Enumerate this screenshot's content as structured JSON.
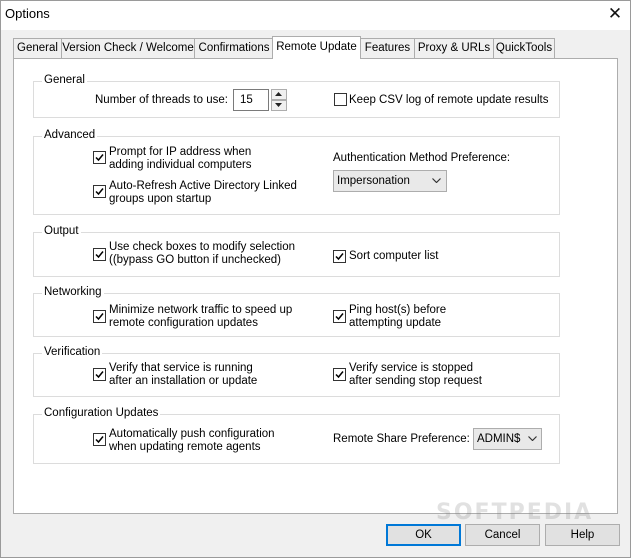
{
  "window": {
    "title": "Options",
    "close_glyph": "✕"
  },
  "tabs": [
    "General",
    "Version Check / Welcome",
    "Confirmations",
    "Remote Update",
    "Features",
    "Proxy & URLs",
    "QuickTools"
  ],
  "active_tab": "Remote Update",
  "general": {
    "label": "General",
    "threads_label": "Number of threads to use:",
    "threads_value": "15",
    "keep_csv": {
      "label": "Keep CSV log of remote update results",
      "checked": false
    }
  },
  "advanced": {
    "label": "Advanced",
    "prompt_ip": {
      "line1": "Prompt for IP address when",
      "line2": "adding individual computers",
      "checked": true
    },
    "auto_refresh": {
      "line1": "Auto-Refresh Active Directory Linked",
      "line2": "groups upon startup",
      "checked": true
    },
    "auth_label": "Authentication Method Preference:",
    "auth_value": "Impersonation"
  },
  "output": {
    "label": "Output",
    "use_checkboxes": {
      "line1": "Use check boxes to modify selection",
      "line2": "((bypass GO  button if unchecked)",
      "checked": true
    },
    "sort_list": {
      "label": "Sort computer list",
      "checked": true
    }
  },
  "networking": {
    "label": "Networking",
    "minimize_traffic": {
      "line1": "Minimize network traffic to speed up",
      "line2": "remote configuration updates",
      "checked": true
    },
    "ping_hosts": {
      "line1": "Ping host(s) before",
      "line2": "attempting update",
      "checked": true
    }
  },
  "verification": {
    "label": "Verification",
    "verify_running": {
      "line1": "Verify that service is running",
      "line2": "after an installation or update",
      "checked": true
    },
    "verify_stopped": {
      "line1": "Verify service is stopped",
      "line2": "after sending stop request",
      "checked": true
    }
  },
  "config_updates": {
    "label": "Configuration Updates",
    "auto_push": {
      "line1": "Automatically push configuration",
      "line2": "when updating remote agents",
      "checked": true
    },
    "share_label": "Remote Share Preference:",
    "share_value": "ADMIN$"
  },
  "buttons": {
    "ok": "OK",
    "cancel": "Cancel",
    "help": "Help"
  },
  "watermark": "SOFTPEDIA"
}
